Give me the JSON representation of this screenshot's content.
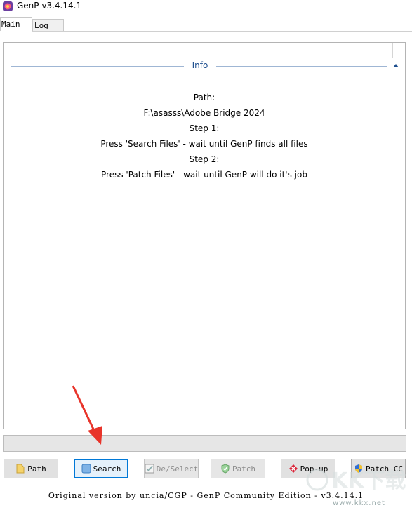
{
  "window": {
    "title": "GenP v3.4.14.1",
    "icon": "genp-app-icon"
  },
  "tabs": [
    {
      "label": "Main",
      "active": true
    },
    {
      "label": "Log",
      "active": false
    }
  ],
  "info": {
    "label": "Info",
    "lines": [
      "Path:",
      "F:\\asasss\\Adobe Bridge 2024",
      "Step 1:",
      "Press 'Search Files' - wait until GenP finds all files",
      "Step 2:",
      "Press 'Patch Files' - wait until GenP will do it's job"
    ]
  },
  "buttons": [
    {
      "label": "Path",
      "icon": "folder-icon",
      "enabled": true
    },
    {
      "label": "Search",
      "icon": "search-icon",
      "enabled": true,
      "focused": true
    },
    {
      "label": "De/Select",
      "icon": "checkbox-icon",
      "enabled": false
    },
    {
      "label": "Patch",
      "icon": "shield-check-icon",
      "enabled": false
    },
    {
      "label": "Pop-up",
      "icon": "x-shield-icon",
      "enabled": true
    },
    {
      "label": "Patch CC",
      "icon": "uac-shield-icon",
      "enabled": true
    }
  ],
  "footer": "Original version by uncia/CGP - GenP Community Edition - v3.4.14.1",
  "watermark": {
    "brand": "KK下载",
    "url": "www.kkx.net"
  },
  "colors": {
    "focus": "#0078d7",
    "arrow": "#e8342a",
    "info": "#1e4f8f"
  }
}
